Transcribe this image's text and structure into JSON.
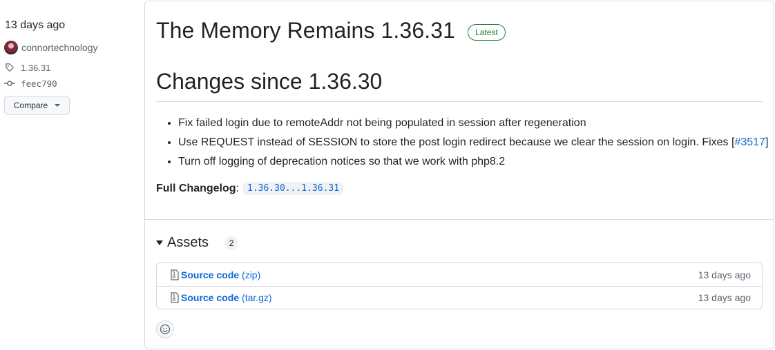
{
  "meta": {
    "date": "13 days ago",
    "author": "connortechnology",
    "tag": "1.36.31",
    "commit": "feec790",
    "compare_label": "Compare"
  },
  "release": {
    "title": "The Memory Remains 1.36.31",
    "badge": "Latest",
    "heading": "Changes since 1.36.30",
    "notes": [
      {
        "text": "Fix failed login due to remoteAddr not being populated in session after regeneration"
      },
      {
        "text": "Use REQUEST instead of SESSION to store the post login redirect because we clear the session on login. Fixes [",
        "link": "#3517",
        "suffix": "]"
      },
      {
        "text": "Turn off logging of deprecation notices so that we work with php8.2"
      }
    ],
    "changelog_label": "Full Changelog",
    "changelog_colon": ":",
    "changelog_link": "1.36.30...1.36.31"
  },
  "assets": {
    "label": "Assets",
    "count": "2",
    "items": [
      {
        "name": "Source code",
        "ext": "(zip)",
        "date": "13 days ago"
      },
      {
        "name": "Source code",
        "ext": "(tar.gz)",
        "date": "13 days ago"
      }
    ]
  },
  "colors": {
    "link": "#0969da",
    "latest_badge": "#1a7f37",
    "border": "#d1d9e0",
    "muted_text": "#59636e"
  },
  "icons": [
    "avatar",
    "tag-icon",
    "commit-icon",
    "caret-down-icon",
    "file-zip-icon",
    "smiley-icon"
  ]
}
